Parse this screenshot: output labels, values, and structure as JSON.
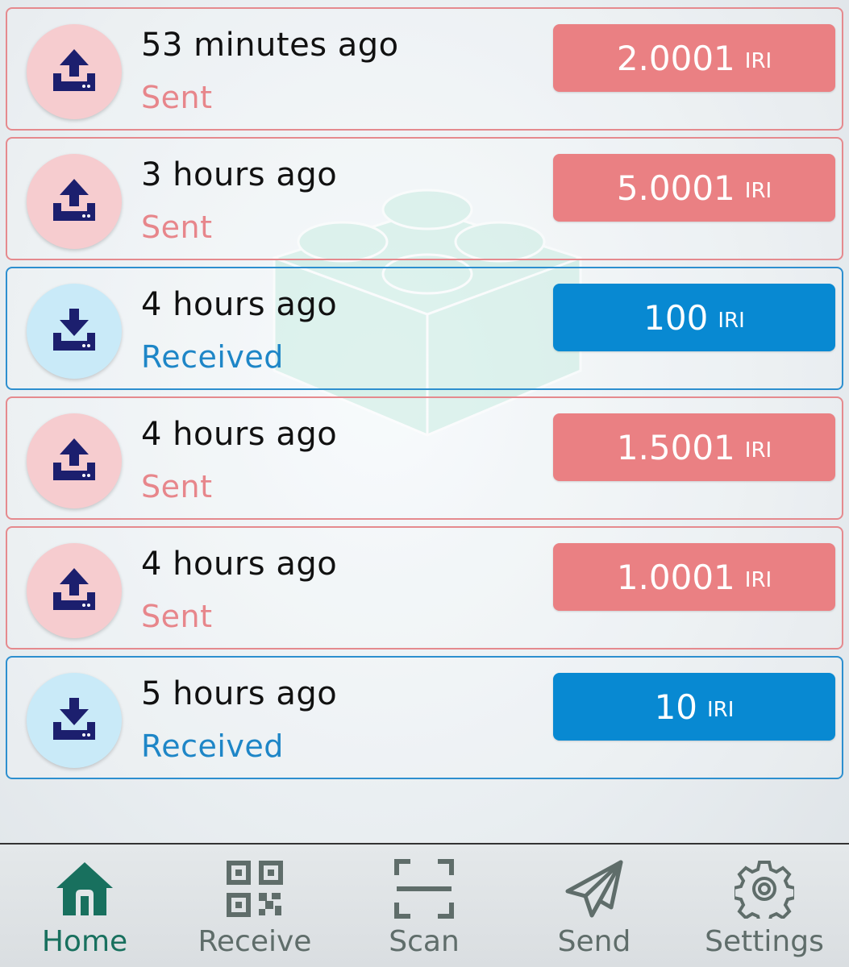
{
  "transactions": [
    {
      "time": "53 minutes ago",
      "status": "Sent",
      "type": "sent",
      "amount": "2.0001",
      "unit": "IRI",
      "icon": "upload-icon"
    },
    {
      "time": "3 hours ago",
      "status": "Sent",
      "type": "sent",
      "amount": "5.0001",
      "unit": "IRI",
      "icon": "upload-icon"
    },
    {
      "time": "4 hours ago",
      "status": "Received",
      "type": "received",
      "amount": "100",
      "unit": "IRI",
      "icon": "download-icon"
    },
    {
      "time": "4 hours ago",
      "status": "Sent",
      "type": "sent",
      "amount": "1.5001",
      "unit": "IRI",
      "icon": "upload-icon"
    },
    {
      "time": "4 hours ago",
      "status": "Sent",
      "type": "sent",
      "amount": "1.0001",
      "unit": "IRI",
      "icon": "upload-icon"
    },
    {
      "time": "5 hours ago",
      "status": "Received",
      "type": "received",
      "amount": "10",
      "unit": "IRI",
      "icon": "download-icon"
    }
  ],
  "nav": {
    "items": [
      {
        "label": "Home",
        "icon": "home-icon",
        "active": true
      },
      {
        "label": "Receive",
        "icon": "qr-code-icon",
        "active": false
      },
      {
        "label": "Scan",
        "icon": "scan-icon",
        "active": false
      },
      {
        "label": "Send",
        "icon": "paper-plane-icon",
        "active": false
      },
      {
        "label": "Settings",
        "icon": "gear-icon",
        "active": false
      }
    ]
  },
  "colors": {
    "sent_accent": "#ea8083",
    "received_accent": "#0889d2",
    "icon_navy": "#1c1f6e",
    "nav_active": "#18705e",
    "nav_inactive": "#5f6d6a"
  }
}
